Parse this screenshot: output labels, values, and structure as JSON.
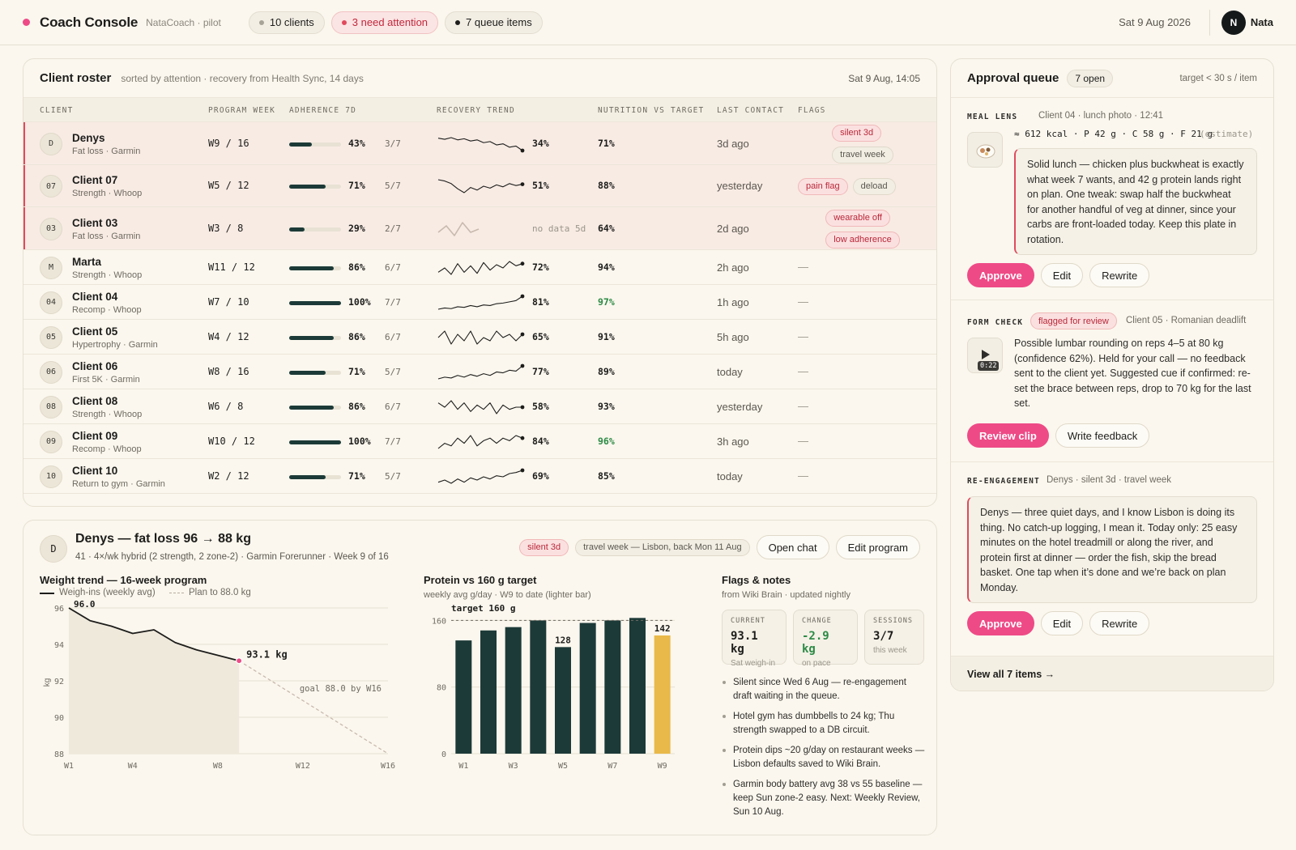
{
  "header": {
    "brand": "Coach Console",
    "brand_sub": "NataCoach · pilot",
    "pills": [
      {
        "label": "10 clients",
        "dot": "#a8a397"
      },
      {
        "label": "3 need attention",
        "dot": "#e04a5c"
      },
      {
        "label": "7 queue items",
        "dot": "#1d1d1b"
      }
    ],
    "date": "Sat 9 Aug 2026",
    "user_initial": "N",
    "user_name": "Nata"
  },
  "colors": {
    "accent": "#ee4a86",
    "alert": "#e04a5c",
    "bar": "#1c3a38",
    "highlight_bar": "#e9b949",
    "good": "#2c8a45"
  },
  "roster": {
    "title": "Client roster",
    "subtitle": "sorted by attention · recovery from Health Sync, 14 days",
    "timestamp": "Sat 9 Aug, 14:05",
    "columns": [
      "CLIENT",
      "PROGRAM WEEK",
      "ADHERENCE 7D",
      "RECOVERY TREND",
      "NUTRITION VS TARGET",
      "LAST CONTACT",
      "FLAGS"
    ],
    "rows": [
      {
        "initial": "D",
        "name": "Denys",
        "sub": "Fat loss · Garmin",
        "week": "W9 / 16",
        "adh": 43,
        "adh_label": "43%",
        "adh_frac": "3/7",
        "trend": [
          52,
          50,
          53,
          49,
          51,
          47,
          49,
          44,
          46,
          40,
          42,
          36,
          38,
          30
        ],
        "rec": "34%",
        "nut": "71%",
        "nut_good": false,
        "contact": "3d ago",
        "flags": [
          {
            "label": "silent 3d",
            "red": true
          },
          {
            "label": "travel week",
            "red": false
          }
        ],
        "attention": true
      },
      {
        "initial": "07",
        "name": "Client 07",
        "sub": "Strength · Whoop",
        "week": "W5 / 12",
        "adh": 71,
        "adh_label": "71%",
        "adh_frac": "5/7",
        "trend": [
          58,
          56,
          52,
          44,
          38,
          46,
          42,
          48,
          45,
          50,
          47,
          52,
          49,
          51
        ],
        "rec": "51%",
        "nut": "88%",
        "nut_good": false,
        "contact": "yesterday",
        "flags": [
          {
            "label": "pain flag",
            "red": true
          },
          {
            "label": "deload",
            "red": false
          }
        ],
        "attention": true
      },
      {
        "initial": "03",
        "name": "Client 03",
        "sub": "Fat loss · Garmin",
        "week": "W3 / 8",
        "adh": 29,
        "adh_label": "29%",
        "adh_frac": "2/7",
        "trend": [
          50,
          52,
          49,
          53,
          50,
          51
        ],
        "rec_none": "no data 5d",
        "nut": "64%",
        "nut_good": false,
        "contact": "2d ago",
        "flags": [
          {
            "label": "wearable off",
            "red": true
          },
          {
            "label": "low adherence",
            "red": true
          }
        ],
        "attention": true
      },
      {
        "initial": "M",
        "name": "Marta",
        "sub": "Strength · Whoop",
        "week": "W11 / 12",
        "adh": 86,
        "adh_label": "86%",
        "adh_frac": "6/7",
        "trend": [
          64,
          68,
          62,
          72,
          64,
          70,
          63,
          73,
          66,
          71,
          68,
          74,
          70,
          72
        ],
        "rec": "72%",
        "nut": "94%",
        "nut_good": false,
        "contact": "2h ago",
        "flags": [],
        "attention": false
      },
      {
        "initial": "04",
        "name": "Client 04",
        "sub": "Recomp · Whoop",
        "week": "W7 / 10",
        "adh": 100,
        "adh_label": "100%",
        "adh_frac": "7/7",
        "trend": [
          60,
          62,
          61,
          64,
          63,
          66,
          64,
          67,
          66,
          69,
          70,
          72,
          74,
          81
        ],
        "rec": "81%",
        "nut": "97%",
        "nut_good": true,
        "contact": "1h ago",
        "flags": [],
        "attention": false
      },
      {
        "initial": "05",
        "name": "Client 05",
        "sub": "Hypertrophy · Garmin",
        "week": "W4 / 12",
        "adh": 86,
        "adh_label": "86%",
        "adh_frac": "6/7",
        "trend": [
          64,
          66,
          62,
          65,
          63,
          66,
          62,
          64,
          63,
          66,
          64,
          65,
          63,
          65
        ],
        "rec": "65%",
        "nut": "91%",
        "nut_good": false,
        "contact": "5h ago",
        "flags": [],
        "attention": false
      },
      {
        "initial": "06",
        "name": "Client 06",
        "sub": "First 5K · Garmin",
        "week": "W8 / 16",
        "adh": 71,
        "adh_label": "71%",
        "adh_frac": "5/7",
        "trend": [
          62,
          64,
          63,
          66,
          64,
          67,
          65,
          68,
          66,
          70,
          69,
          72,
          71,
          77
        ],
        "rec": "77%",
        "nut": "89%",
        "nut_good": false,
        "contact": "today",
        "flags": [],
        "attention": false
      },
      {
        "initial": "08",
        "name": "Client 08",
        "sub": "Strength · Whoop",
        "week": "W6 / 8",
        "adh": 86,
        "adh_label": "86%",
        "adh_frac": "6/7",
        "trend": [
          60,
          58,
          61,
          57,
          60,
          56,
          59,
          57,
          60,
          55,
          59,
          57,
          58,
          58
        ],
        "rec": "58%",
        "nut": "93%",
        "nut_good": false,
        "contact": "yesterday",
        "flags": [],
        "attention": false
      },
      {
        "initial": "09",
        "name": "Client 09",
        "sub": "Recomp · Whoop",
        "week": "W10 / 12",
        "adh": 100,
        "adh_label": "100%",
        "adh_frac": "7/7",
        "trend": [
          80,
          82,
          81,
          84,
          82,
          85,
          81,
          83,
          84,
          82,
          84,
          83,
          85,
          84
        ],
        "rec": "84%",
        "nut": "96%",
        "nut_good": true,
        "contact": "3h ago",
        "flags": [],
        "attention": false
      },
      {
        "initial": "10",
        "name": "Client 10",
        "sub": "Return to gym · Garmin",
        "week": "W2 / 12",
        "adh": 71,
        "adh_label": "71%",
        "adh_frac": "5/7",
        "trend": [
          58,
          60,
          57,
          61,
          58,
          62,
          60,
          63,
          61,
          64,
          63,
          66,
          67,
          69
        ],
        "rec": "69%",
        "nut": "85%",
        "nut_good": false,
        "contact": "today",
        "flags": [],
        "attention": false
      }
    ]
  },
  "detail": {
    "initial": "D",
    "title": "Denys — fat loss 96 → 88 kg",
    "subtitle": "41 · 4×/wk hybrid (2 strength, 2 zone-2) · Garmin Forerunner · Week 9 of 16",
    "badges": [
      {
        "label": "silent 3d",
        "red": true
      },
      {
        "label": "travel week — Lisbon, back Mon 11 Aug",
        "red": false
      }
    ],
    "actions": [
      "Open chat",
      "Edit program"
    ],
    "weight": {
      "title": "Weight trend — 16-week program",
      "legend_actual": "Weigh-ins (weekly avg)",
      "legend_plan": "Plan to 88.0 kg",
      "start_label": "96.0",
      "current_label": "93.1 kg",
      "goal_label": "goal 88.0 by W16",
      "ylabel": "kg"
    },
    "protein": {
      "title": "Protein vs 160 g target",
      "subtitle": "weekly avg g/day · W9 to date (lighter bar)",
      "target_label": "target 160 g"
    },
    "flags_notes": {
      "title": "Flags & notes",
      "subtitle": "from Wiki Brain · updated nightly",
      "stats": [
        {
          "label": "CURRENT",
          "value": "93.1 kg",
          "caption": "Sat weigh-in",
          "green": false
        },
        {
          "label": "CHANGE",
          "value": "-2.9 kg",
          "caption": "on pace",
          "green": true
        },
        {
          "label": "SESSIONS",
          "value": "3/7",
          "caption": "this week",
          "green": false
        }
      ],
      "notes": [
        "Silent since Wed 6 Aug — re-engagement draft waiting in the queue.",
        "Hotel gym has dumbbells to 24 kg; Thu strength swapped to a DB circuit.",
        "Protein dips ~20 g/day on restaurant weeks — Lisbon defaults saved to Wiki Brain.",
        "Garmin body battery avg 38 vs 55 baseline — keep Sun zone-2 easy. Next: Weekly Review, Sun 10 Aug."
      ]
    }
  },
  "chart_data": [
    {
      "type": "line",
      "title": "Weight trend — 16-week program",
      "ylabel": "kg",
      "x_ticks": [
        "W1",
        "W4",
        "W8",
        "W12",
        "W16"
      ],
      "xlim": [
        1,
        16
      ],
      "ylim": [
        88,
        96
      ],
      "y_ticks": [
        88,
        90,
        92,
        94,
        96
      ],
      "series": [
        {
          "name": "Weigh-ins (weekly avg)",
          "x": [
            1,
            2,
            3,
            4,
            5,
            6,
            7,
            8,
            9
          ],
          "values": [
            96.0,
            95.3,
            95.0,
            94.6,
            94.8,
            94.1,
            93.7,
            93.4,
            93.1
          ]
        },
        {
          "name": "Plan to 88.0 kg",
          "x": [
            9,
            16
          ],
          "values": [
            93.1,
            88.0
          ]
        }
      ],
      "annotations": [
        "96.0",
        "93.1 kg",
        "goal 88.0 by W16"
      ]
    },
    {
      "type": "bar",
      "title": "Protein vs 160 g target",
      "categories": [
        "W1",
        "W2",
        "W3",
        "W4",
        "W5",
        "W6",
        "W7",
        "W8",
        "W9"
      ],
      "x_tick_labels": [
        "W1",
        "W3",
        "W5",
        "W7",
        "W9"
      ],
      "values": [
        136,
        148,
        152,
        160,
        128,
        157,
        160,
        163,
        142
      ],
      "data_labels": {
        "4": "128",
        "8": "142"
      },
      "highlight_index": 8,
      "target": 160,
      "target_label": "target 160 g",
      "ylim": [
        0,
        175
      ],
      "y_ticks": [
        0,
        80,
        160
      ]
    }
  ],
  "queue": {
    "title": "Approval queue",
    "count": "7 open",
    "target": "target < 30 s / item",
    "items": [
      {
        "kind": "MEAL LENS",
        "meta": "Client 04 · lunch photo · 12:41",
        "macros": "≈ 612 kcal · P 42 g · C 58 g · F 21 g",
        "macros_note": "(estimate)",
        "text": "Solid lunch — chicken plus buckwheat is exactly what week 7 wants, and 42 g protein lands right on plan. One tweak: swap half the buckwheat for another handful of veg at dinner, since your carbs are front-loaded today. Keep this plate in rotation.",
        "buttons": [
          "Approve",
          "Edit",
          "Rewrite"
        ]
      },
      {
        "kind": "FORM CHECK",
        "badge": "flagged for review",
        "meta": "Client 05 · Romanian deadlift",
        "duration": "0:22",
        "text": "Possible lumbar rounding on reps 4–5 at 80 kg (confidence 62%). Held for your call — no feedback sent to the client yet. Suggested cue if confirmed: re-set the brace between reps, drop to 70 kg for the last set.",
        "buttons": [
          "Review clip",
          "Write feedback"
        ]
      },
      {
        "kind": "RE-ENGAGEMENT",
        "meta": "Denys · silent 3d · travel week",
        "text": "Denys — three quiet days, and I know Lisbon is doing its thing. No catch-up logging, I mean it. Today only: 25 easy minutes on the hotel treadmill or along the river, and protein first at dinner — order the fish, skip the bread basket. One tap when it’s done and we’re back on plan Monday.",
        "buttons": [
          "Approve",
          "Edit",
          "Rewrite"
        ]
      }
    ],
    "footer": "View all 7 items →"
  }
}
